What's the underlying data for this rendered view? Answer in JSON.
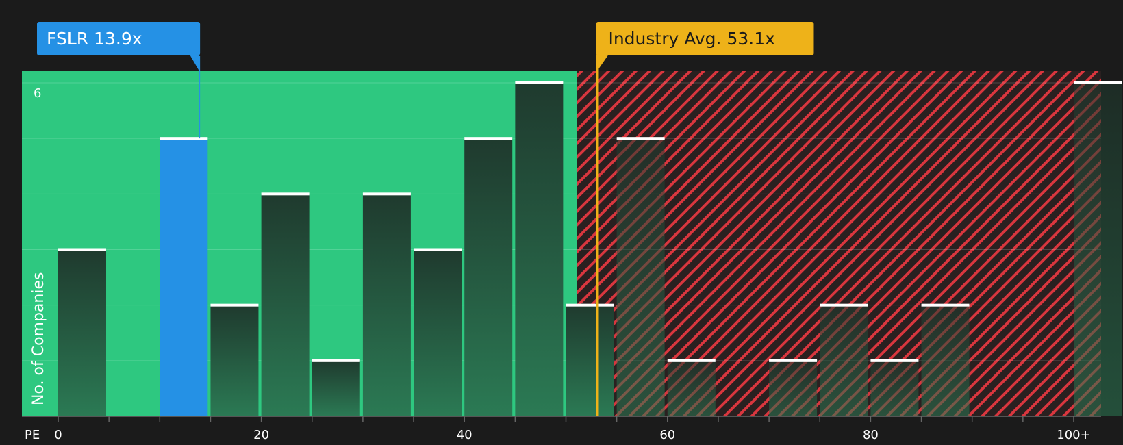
{
  "chart_data": {
    "type": "bar",
    "ylabel": "No. of Companies",
    "xlabel": "PE",
    "ylim": [
      0,
      6.2
    ],
    "y_ticks": [
      {
        "value": 6,
        "label": "6"
      }
    ],
    "x_range": [
      -5,
      102.5
    ],
    "x_ticks": [
      {
        "value": 0,
        "label": "0"
      },
      {
        "value": 20,
        "label": "20"
      },
      {
        "value": 40,
        "label": "40"
      },
      {
        "value": 60,
        "label": "60"
      },
      {
        "value": 80,
        "label": "80"
      },
      {
        "value": 100,
        "label": "100+"
      }
    ],
    "bin_width": 5,
    "bins": [
      {
        "start": 0,
        "count": 3
      },
      {
        "start": 5,
        "count": 0
      },
      {
        "start": 10,
        "count": 5,
        "highlight": true
      },
      {
        "start": 15,
        "count": 2
      },
      {
        "start": 20,
        "count": 4
      },
      {
        "start": 25,
        "count": 1
      },
      {
        "start": 30,
        "count": 4
      },
      {
        "start": 35,
        "count": 3
      },
      {
        "start": 40,
        "count": 5
      },
      {
        "start": 45,
        "count": 6
      },
      {
        "start": 50,
        "count": 2
      },
      {
        "start": 55,
        "count": 5
      },
      {
        "start": 60,
        "count": 1
      },
      {
        "start": 65,
        "count": 0
      },
      {
        "start": 70,
        "count": 1
      },
      {
        "start": 75,
        "count": 2
      },
      {
        "start": 80,
        "count": 1
      },
      {
        "start": 85,
        "count": 2
      },
      {
        "start": 90,
        "count": 0
      },
      {
        "start": 95,
        "count": 0
      },
      {
        "start": 100,
        "count": 6
      }
    ],
    "company": {
      "ticker": "FSLR",
      "value": 13.9,
      "label": "FSLR 13.9x"
    },
    "industry": {
      "value": 53.1,
      "label": "Industry Avg. 53.1x"
    },
    "fair_zone_end": 51.1,
    "colors": {
      "background": "#1b1b1b",
      "fair_zone": "#2ec880",
      "over_zone": "#2a2020",
      "hatch": "#d9363e",
      "bar_top": "#1f3a2e",
      "bar_bottom": "#2b7a54",
      "highlight": "#2591e5",
      "industry": "#eeb219",
      "cap": "#ffffff"
    }
  }
}
